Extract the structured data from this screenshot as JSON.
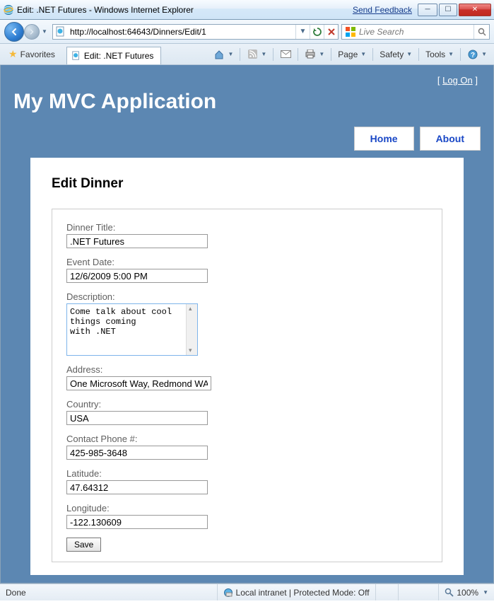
{
  "window": {
    "title": "Edit: .NET Futures - Windows Internet Explorer",
    "feedback_link": "Send Feedback"
  },
  "address": {
    "url": "http://localhost:64643/Dinners/Edit/1"
  },
  "search": {
    "placeholder": "Live Search"
  },
  "favorites_label": "Favorites",
  "tab": {
    "title": "Edit: .NET Futures"
  },
  "commands": {
    "page": "Page",
    "safety": "Safety",
    "tools": "Tools"
  },
  "app": {
    "logon": "Log On",
    "title": "My MVC Application",
    "menu": {
      "home": "Home",
      "about": "About"
    }
  },
  "form": {
    "heading": "Edit Dinner",
    "dinner_title_label": "Dinner Title:",
    "dinner_title_value": ".NET Futures",
    "event_date_label": "Event Date:",
    "event_date_value": "12/6/2009 5:00 PM",
    "description_label": "Description:",
    "description_value": "Come talk about cool things coming\nwith .NET",
    "address_label": "Address:",
    "address_value": "One Microsoft Way, Redmond WA",
    "country_label": "Country:",
    "country_value": "USA",
    "phone_label": "Contact Phone #:",
    "phone_value": "425-985-3648",
    "latitude_label": "Latitude:",
    "latitude_value": "47.64312",
    "longitude_label": "Longitude:",
    "longitude_value": "-122.130609",
    "save_label": "Save"
  },
  "status": {
    "done": "Done",
    "zone": "Local intranet | Protected Mode: Off",
    "zoom": "100%"
  }
}
